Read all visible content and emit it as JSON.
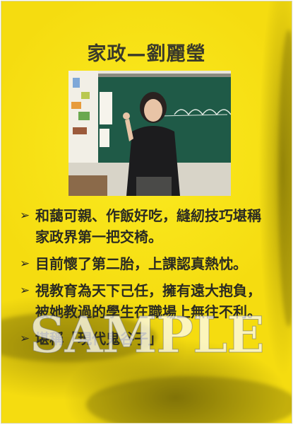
{
  "poster": {
    "title": "家政—劉麗瑩",
    "photo_icon": "portrait-photo",
    "bullets": [
      "和藹可親、作飯好吃，縫紉技巧堪稱家政界第一把交椅。",
      "目前懷了第二胎，上課認真熱忱。",
      "視教育為天下己任，擁有遠大抱負，被她教過的學生在職場上無往不利。",
      "堪稱「現代鬼谷子」"
    ],
    "watermark": "SAMPLE",
    "colors": {
      "background": "#f5dc10",
      "text": "#2b2b22"
    }
  }
}
